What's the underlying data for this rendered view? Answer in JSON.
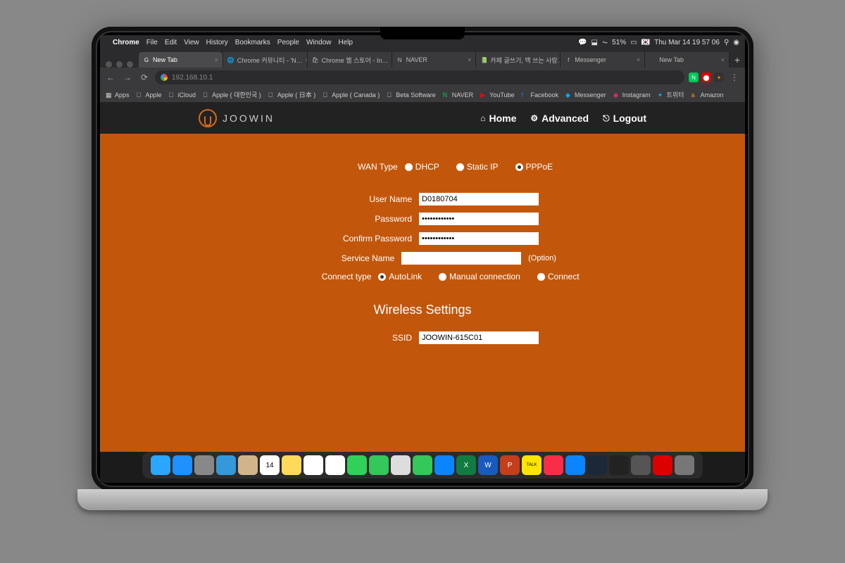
{
  "menubar": {
    "app": "Chrome",
    "items": [
      "File",
      "Edit",
      "View",
      "History",
      "Bookmarks",
      "People",
      "Window",
      "Help"
    ],
    "battery": "51%",
    "date": "Thu Mar 14  19 57 06"
  },
  "tabs": [
    {
      "label": "New Tab",
      "favicon": "G",
      "active": true
    },
    {
      "label": "Chrome 커뮤니티 - 'N…",
      "favicon": "🌐"
    },
    {
      "label": "Chrome 웹 스토어 - In…",
      "favicon": "🛍"
    },
    {
      "label": "NAVER",
      "favicon": "N"
    },
    {
      "label": "카페 글쓰기, 맥 쓰는 사람…",
      "favicon": "📗"
    },
    {
      "label": "Messenger",
      "favicon": "f"
    },
    {
      "label": "New Tab",
      "favicon": ""
    }
  ],
  "toolbar": {
    "url": "192.168.10.1"
  },
  "bookmarks": [
    {
      "label": "Apps",
      "icon": "▦"
    },
    {
      "label": "Apple",
      "icon": ""
    },
    {
      "label": "iCloud",
      "icon": ""
    },
    {
      "label": "Apple ( 대한민국 )",
      "icon": ""
    },
    {
      "label": "Apple ( 日本 )",
      "icon": ""
    },
    {
      "label": "Apple ( Canada )",
      "icon": ""
    },
    {
      "label": "Beta Software",
      "icon": ""
    },
    {
      "label": "NAVER",
      "icon": "N",
      "color": "#03c75a"
    },
    {
      "label": "YouTube",
      "icon": "▶",
      "color": "#f00"
    },
    {
      "label": "Facebook",
      "icon": "f",
      "color": "#1877f2"
    },
    {
      "label": "Messenger",
      "icon": "◆",
      "color": "#0af"
    },
    {
      "label": "Instagram",
      "icon": "◉",
      "color": "#e1306c"
    },
    {
      "label": "트위터",
      "icon": "✦",
      "color": "#1da1f2"
    },
    {
      "label": "Amazon",
      "icon": "a",
      "color": "#ff9900"
    }
  ],
  "page": {
    "brand": "JOOWIN",
    "nav": {
      "home": "Home",
      "advanced": "Advanced",
      "logout": "Logout"
    },
    "wan": {
      "label": "WAN Type",
      "options": [
        "DHCP",
        "Static IP",
        "PPPoE"
      ],
      "selected": "PPPoE"
    },
    "fields": {
      "username_label": "User Name",
      "username_value": "D0180704",
      "password_label": "Password",
      "password_value": "••••••••••••",
      "confirm_label": "Confirm Password",
      "confirm_value": "••••••••••••",
      "service_label": "Service Name",
      "service_value": "",
      "service_suffix": "(Option)",
      "connect_label": "Connect type",
      "connect_options": [
        "AutoLink",
        "Manual connection",
        "Connect"
      ],
      "connect_selected": "AutoLink"
    },
    "wireless": {
      "title": "Wireless Settings",
      "ssid_label": "SSID",
      "ssid_value": "JOOWIN-615C01"
    }
  },
  "dock": [
    {
      "name": "finder",
      "color": "#2aa6ff"
    },
    {
      "name": "safari",
      "color": "#1e90ff"
    },
    {
      "name": "launchpad",
      "color": "#888"
    },
    {
      "name": "mail",
      "color": "#3498db"
    },
    {
      "name": "contacts",
      "color": "#d2b48c"
    },
    {
      "name": "calendar",
      "color": "#fff",
      "text": "14"
    },
    {
      "name": "notes",
      "color": "#ffd95a"
    },
    {
      "name": "reminders",
      "color": "#fff"
    },
    {
      "name": "photos",
      "color": "#fff"
    },
    {
      "name": "messages",
      "color": "#30d158"
    },
    {
      "name": "facetime",
      "color": "#34c759"
    },
    {
      "name": "maps",
      "color": "#ddd"
    },
    {
      "name": "numbers",
      "color": "#34c759"
    },
    {
      "name": "keynote",
      "color": "#0a84ff"
    },
    {
      "name": "excel",
      "color": "#107c41",
      "text": "X"
    },
    {
      "name": "word",
      "color": "#185abd",
      "text": "W"
    },
    {
      "name": "powerpoint",
      "color": "#c43e1c",
      "text": "P"
    },
    {
      "name": "kakaotalk",
      "color": "#fee500",
      "text": "TALK"
    },
    {
      "name": "music",
      "color": "#fa2d48"
    },
    {
      "name": "appstore",
      "color": "#0a84ff"
    },
    {
      "name": "steam",
      "color": "#1b2838"
    },
    {
      "name": "atom",
      "color": "#222"
    },
    {
      "name": "settings",
      "color": "#555"
    },
    {
      "name": "parallels",
      "color": "#d00"
    },
    {
      "name": "trash",
      "color": "#777"
    }
  ]
}
